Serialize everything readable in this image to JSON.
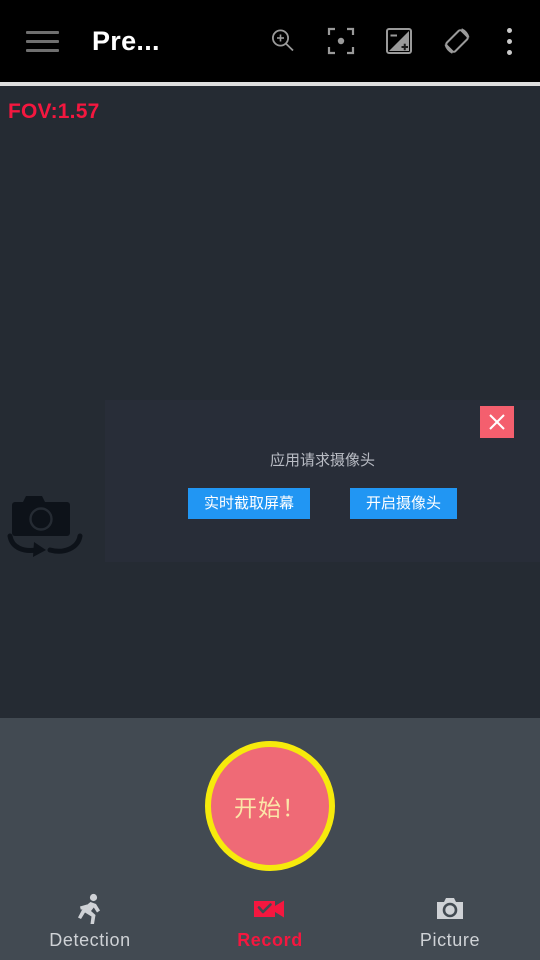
{
  "appbar": {
    "title": "Pre...",
    "menu_icon": "hamburger-menu-icon",
    "actions": [
      {
        "name": "zoom-in-icon",
        "label": "Zoom"
      },
      {
        "name": "focus-center-icon",
        "label": "Focus"
      },
      {
        "name": "exposure-compensation-icon",
        "label": "Exposure"
      },
      {
        "name": "screen-rotation-icon",
        "label": "Rotation"
      }
    ],
    "overflow_icon": "kebab-more-icon"
  },
  "preview": {
    "fov_label": "FOV:1.57",
    "fov_color": "#f4173f",
    "background_color": "#252b33",
    "switch_camera_icon": "switch-camera-icon"
  },
  "dialog": {
    "message": "应用请求摄像头",
    "close_label": "×",
    "close_color": "#f45f6e",
    "background_color": "#282d38",
    "button_color": "#2196f3",
    "buttons": [
      {
        "label": "实时截取屏幕",
        "name": "capture-screen-button"
      },
      {
        "label": "开启摄像头",
        "name": "open-camera-button"
      }
    ]
  },
  "bottom": {
    "background_color": "#424a52",
    "record_button": {
      "label": "开始！",
      "fill_color": "#ef6a76",
      "ring_color": "#f6ea0c",
      "text_color": "#fbe6a8"
    }
  },
  "tabbar": {
    "active_color": "#f4173f",
    "inactive_color": "#cfd2d6",
    "tabs": [
      {
        "label": "Detection",
        "icon": "running-person-icon",
        "active": false
      },
      {
        "label": "Record",
        "icon": "video-camera-check-icon",
        "active": true
      },
      {
        "label": "Picture",
        "icon": "photo-camera-icon",
        "active": false
      }
    ]
  }
}
